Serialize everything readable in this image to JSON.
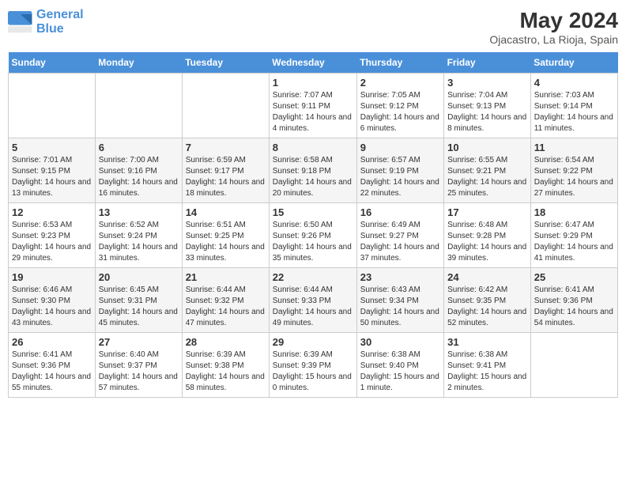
{
  "header": {
    "logo_line1": "General",
    "logo_line2": "Blue",
    "title": "May 2024",
    "subtitle": "Ojacastro, La Rioja, Spain"
  },
  "days_of_week": [
    "Sunday",
    "Monday",
    "Tuesday",
    "Wednesday",
    "Thursday",
    "Friday",
    "Saturday"
  ],
  "weeks": [
    [
      {
        "day": "",
        "sunrise": "",
        "sunset": "",
        "daylight": ""
      },
      {
        "day": "",
        "sunrise": "",
        "sunset": "",
        "daylight": ""
      },
      {
        "day": "",
        "sunrise": "",
        "sunset": "",
        "daylight": ""
      },
      {
        "day": "1",
        "sunrise": "Sunrise: 7:07 AM",
        "sunset": "Sunset: 9:11 PM",
        "daylight": "Daylight: 14 hours and 4 minutes."
      },
      {
        "day": "2",
        "sunrise": "Sunrise: 7:05 AM",
        "sunset": "Sunset: 9:12 PM",
        "daylight": "Daylight: 14 hours and 6 minutes."
      },
      {
        "day": "3",
        "sunrise": "Sunrise: 7:04 AM",
        "sunset": "Sunset: 9:13 PM",
        "daylight": "Daylight: 14 hours and 8 minutes."
      },
      {
        "day": "4",
        "sunrise": "Sunrise: 7:03 AM",
        "sunset": "Sunset: 9:14 PM",
        "daylight": "Daylight: 14 hours and 11 minutes."
      }
    ],
    [
      {
        "day": "5",
        "sunrise": "Sunrise: 7:01 AM",
        "sunset": "Sunset: 9:15 PM",
        "daylight": "Daylight: 14 hours and 13 minutes."
      },
      {
        "day": "6",
        "sunrise": "Sunrise: 7:00 AM",
        "sunset": "Sunset: 9:16 PM",
        "daylight": "Daylight: 14 hours and 16 minutes."
      },
      {
        "day": "7",
        "sunrise": "Sunrise: 6:59 AM",
        "sunset": "Sunset: 9:17 PM",
        "daylight": "Daylight: 14 hours and 18 minutes."
      },
      {
        "day": "8",
        "sunrise": "Sunrise: 6:58 AM",
        "sunset": "Sunset: 9:18 PM",
        "daylight": "Daylight: 14 hours and 20 minutes."
      },
      {
        "day": "9",
        "sunrise": "Sunrise: 6:57 AM",
        "sunset": "Sunset: 9:19 PM",
        "daylight": "Daylight: 14 hours and 22 minutes."
      },
      {
        "day": "10",
        "sunrise": "Sunrise: 6:55 AM",
        "sunset": "Sunset: 9:21 PM",
        "daylight": "Daylight: 14 hours and 25 minutes."
      },
      {
        "day": "11",
        "sunrise": "Sunrise: 6:54 AM",
        "sunset": "Sunset: 9:22 PM",
        "daylight": "Daylight: 14 hours and 27 minutes."
      }
    ],
    [
      {
        "day": "12",
        "sunrise": "Sunrise: 6:53 AM",
        "sunset": "Sunset: 9:23 PM",
        "daylight": "Daylight: 14 hours and 29 minutes."
      },
      {
        "day": "13",
        "sunrise": "Sunrise: 6:52 AM",
        "sunset": "Sunset: 9:24 PM",
        "daylight": "Daylight: 14 hours and 31 minutes."
      },
      {
        "day": "14",
        "sunrise": "Sunrise: 6:51 AM",
        "sunset": "Sunset: 9:25 PM",
        "daylight": "Daylight: 14 hours and 33 minutes."
      },
      {
        "day": "15",
        "sunrise": "Sunrise: 6:50 AM",
        "sunset": "Sunset: 9:26 PM",
        "daylight": "Daylight: 14 hours and 35 minutes."
      },
      {
        "day": "16",
        "sunrise": "Sunrise: 6:49 AM",
        "sunset": "Sunset: 9:27 PM",
        "daylight": "Daylight: 14 hours and 37 minutes."
      },
      {
        "day": "17",
        "sunrise": "Sunrise: 6:48 AM",
        "sunset": "Sunset: 9:28 PM",
        "daylight": "Daylight: 14 hours and 39 minutes."
      },
      {
        "day": "18",
        "sunrise": "Sunrise: 6:47 AM",
        "sunset": "Sunset: 9:29 PM",
        "daylight": "Daylight: 14 hours and 41 minutes."
      }
    ],
    [
      {
        "day": "19",
        "sunrise": "Sunrise: 6:46 AM",
        "sunset": "Sunset: 9:30 PM",
        "daylight": "Daylight: 14 hours and 43 minutes."
      },
      {
        "day": "20",
        "sunrise": "Sunrise: 6:45 AM",
        "sunset": "Sunset: 9:31 PM",
        "daylight": "Daylight: 14 hours and 45 minutes."
      },
      {
        "day": "21",
        "sunrise": "Sunrise: 6:44 AM",
        "sunset": "Sunset: 9:32 PM",
        "daylight": "Daylight: 14 hours and 47 minutes."
      },
      {
        "day": "22",
        "sunrise": "Sunrise: 6:44 AM",
        "sunset": "Sunset: 9:33 PM",
        "daylight": "Daylight: 14 hours and 49 minutes."
      },
      {
        "day": "23",
        "sunrise": "Sunrise: 6:43 AM",
        "sunset": "Sunset: 9:34 PM",
        "daylight": "Daylight: 14 hours and 50 minutes."
      },
      {
        "day": "24",
        "sunrise": "Sunrise: 6:42 AM",
        "sunset": "Sunset: 9:35 PM",
        "daylight": "Daylight: 14 hours and 52 minutes."
      },
      {
        "day": "25",
        "sunrise": "Sunrise: 6:41 AM",
        "sunset": "Sunset: 9:36 PM",
        "daylight": "Daylight: 14 hours and 54 minutes."
      }
    ],
    [
      {
        "day": "26",
        "sunrise": "Sunrise: 6:41 AM",
        "sunset": "Sunset: 9:36 PM",
        "daylight": "Daylight: 14 hours and 55 minutes."
      },
      {
        "day": "27",
        "sunrise": "Sunrise: 6:40 AM",
        "sunset": "Sunset: 9:37 PM",
        "daylight": "Daylight: 14 hours and 57 minutes."
      },
      {
        "day": "28",
        "sunrise": "Sunrise: 6:39 AM",
        "sunset": "Sunset: 9:38 PM",
        "daylight": "Daylight: 14 hours and 58 minutes."
      },
      {
        "day": "29",
        "sunrise": "Sunrise: 6:39 AM",
        "sunset": "Sunset: 9:39 PM",
        "daylight": "Daylight: 15 hours and 0 minutes."
      },
      {
        "day": "30",
        "sunrise": "Sunrise: 6:38 AM",
        "sunset": "Sunset: 9:40 PM",
        "daylight": "Daylight: 15 hours and 1 minute."
      },
      {
        "day": "31",
        "sunrise": "Sunrise: 6:38 AM",
        "sunset": "Sunset: 9:41 PM",
        "daylight": "Daylight: 15 hours and 2 minutes."
      },
      {
        "day": "",
        "sunrise": "",
        "sunset": "",
        "daylight": ""
      }
    ]
  ]
}
